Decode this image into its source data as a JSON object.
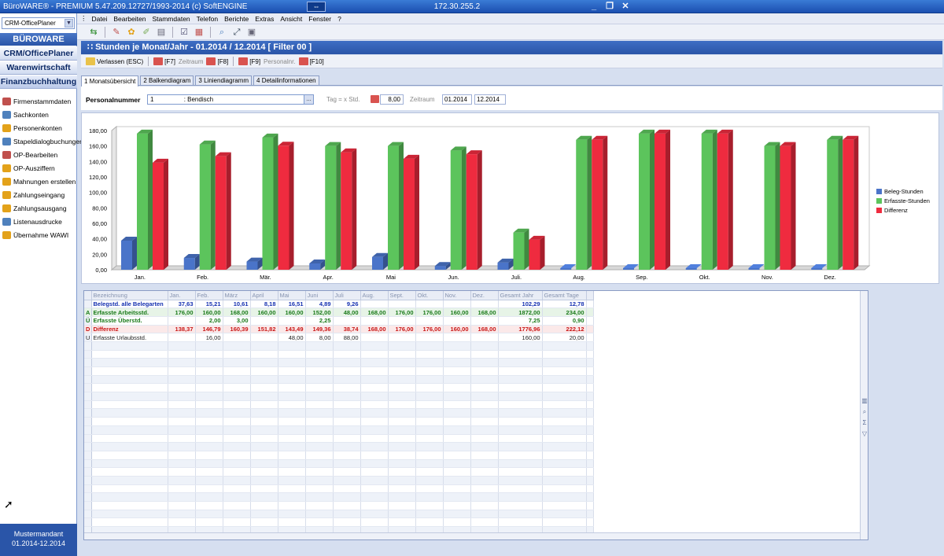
{
  "window": {
    "title": "BüroWARE® - PREMIUM  5.47.209.12727/1993-2014 (c) SoftENGINE",
    "ip": "172.30.255.2",
    "pin_icon": "pin-icon",
    "minimize": "_",
    "restore": "❐",
    "close": "✕"
  },
  "sidebar": {
    "selector": "CRM-OfficePlaner",
    "brand": "BÜROWARE RENT",
    "nav": [
      {
        "label": "CRM/OfficePlaner"
      },
      {
        "label": "Warenwirtschaft"
      },
      {
        "label": "Finanzbuchhaltung"
      }
    ],
    "items": [
      {
        "label": "Firmenstammdaten",
        "color": "#c0504d"
      },
      {
        "label": "Sachkonten",
        "color": "#4f81bd"
      },
      {
        "label": "Personenkonten",
        "color": "#e3a21a"
      },
      {
        "label": "Stapeldialogbuchungen",
        "color": "#4f81bd"
      },
      {
        "label": "OP-Bearbeiten",
        "color": "#c0504d"
      },
      {
        "label": "OP-Ausziffern",
        "color": "#e3a21a"
      },
      {
        "label": "Mahnungen erstellen",
        "color": "#e3a21a"
      },
      {
        "label": "Zahlungseingang",
        "color": "#e3a21a"
      },
      {
        "label": "Zahlungsausgang",
        "color": "#e3a21a"
      },
      {
        "label": "Listenausdrucke",
        "color": "#4f81bd"
      },
      {
        "label": "Übernahme WAWI",
        "color": "#e3a21a"
      }
    ],
    "footer_line1": "Mustermandant",
    "footer_line2": "01.2014-12.2014"
  },
  "menu": [
    "Datei",
    "Bearbeiten",
    "Stammdaten",
    "Telefon",
    "Berichte",
    "Extras",
    "Ansicht",
    "Fenster",
    "?"
  ],
  "module": {
    "title": "Stunden je Monat/Jahr - 01.2014 / 12.2014 [ Filter 00 ]",
    "fkeys": [
      {
        "label": "Verlassen (ESC)",
        "style": "y"
      },
      {
        "label": "[F7]",
        "style": "r"
      },
      {
        "label": "Zeitraum",
        "style": "gray"
      },
      {
        "label": "[F8]",
        "style": "r"
      },
      {
        "label": "[F9]",
        "style": "r"
      },
      {
        "label": "Personalnr.",
        "style": "gray"
      },
      {
        "label": "[F10]",
        "style": "r"
      }
    ],
    "tabs": [
      {
        "label": "1 Monatsübersicht",
        "active": true
      },
      {
        "label": "2 Balkendiagram",
        "active": false
      },
      {
        "label": "3 Liniendiagramm",
        "active": false
      },
      {
        "label": "4 Detailinformationen",
        "active": false
      }
    ]
  },
  "filter": {
    "label": "Personalnummer",
    "value": "1",
    "name": ": Bendisch",
    "tag_label": "Tag = x Std.",
    "tag_value": "8,00",
    "period_label": "Zeitraum",
    "period_from": "01.2014",
    "period_to": "12.2014"
  },
  "chart_data": {
    "type": "bar",
    "categories": [
      "Jan.",
      "Feb.",
      "Mär.",
      "Apr.",
      "Mai",
      "Jun.",
      "Juli.",
      "Aug.",
      "Sep.",
      "Okt.",
      "Nov.",
      "Dez."
    ],
    "series": [
      {
        "name": "Beleg-Stunden",
        "color": "#4a74c9",
        "values": [
          37.63,
          15.21,
          10.61,
          8.18,
          16.51,
          4.89,
          9.26,
          0,
          0,
          0,
          0,
          0
        ]
      },
      {
        "name": "Erfasste-Stunden",
        "color": "#5cc45c",
        "values": [
          176.0,
          162.0,
          171.0,
          160.0,
          160.0,
          154.25,
          48.0,
          168.0,
          176.0,
          176.0,
          160.0,
          168.0
        ]
      },
      {
        "name": "Differenz",
        "color": "#ef2b3f",
        "values": [
          138.37,
          146.79,
          160.39,
          151.82,
          143.49,
          149.36,
          38.74,
          168.0,
          176.0,
          176.0,
          160.0,
          168.0
        ]
      }
    ],
    "yticks": [
      "0,00",
      "20,00",
      "40,00",
      "60,00",
      "80,00",
      "100,00",
      "120,00",
      "140,00",
      "160,00",
      "180,00"
    ],
    "ylim": [
      0,
      180
    ],
    "legend_position": "right",
    "grid": false
  },
  "grid": {
    "headers": [
      "",
      "Bezeichnung",
      "Jan.",
      "Feb.",
      "März",
      "April",
      "Mai",
      "Juni",
      "Juli",
      "Aug.",
      "Sept.",
      "Okt.",
      "Nov.",
      "Dez.",
      "Gesamt Jahr",
      "Gesamt Tage",
      ""
    ],
    "rows": [
      {
        "key": "",
        "label": "Belegstd. alle Belegarten",
        "cells": [
          "37,63",
          "15,21",
          "10,61",
          "8,18",
          "16,51",
          "4,89",
          "9,26",
          "",
          "",
          "",
          "",
          "",
          "102,29",
          "12,78"
        ]
      },
      {
        "key": "A",
        "label": "Erfasste Arbeitsstd.",
        "cells": [
          "176,00",
          "160,00",
          "168,00",
          "160,00",
          "160,00",
          "152,00",
          "48,00",
          "168,00",
          "176,00",
          "176,00",
          "160,00",
          "168,00",
          "1872,00",
          "234,00"
        ]
      },
      {
        "key": "Ü",
        "label": "Erfasste Überstd.",
        "cells": [
          "",
          "2,00",
          "3,00",
          "",
          "",
          "2,25",
          "",
          "",
          "",
          "",
          "",
          "",
          "7,25",
          "0,90"
        ]
      },
      {
        "key": "D",
        "label": "Differenz",
        "cells": [
          "138,37",
          "146,79",
          "160,39",
          "151,82",
          "143,49",
          "149,36",
          "38,74",
          "168,00",
          "176,00",
          "176,00",
          "160,00",
          "168,00",
          "1776,96",
          "222,12"
        ]
      },
      {
        "key": "U",
        "label": "Erfasste Urlaubsstd.",
        "cells": [
          "",
          "16,00",
          "",
          "",
          "48,00",
          "8,00",
          "88,00",
          "",
          "",
          "",
          "",
          "",
          "160,00",
          "20,00"
        ]
      }
    ],
    "empty_rows": 23
  }
}
